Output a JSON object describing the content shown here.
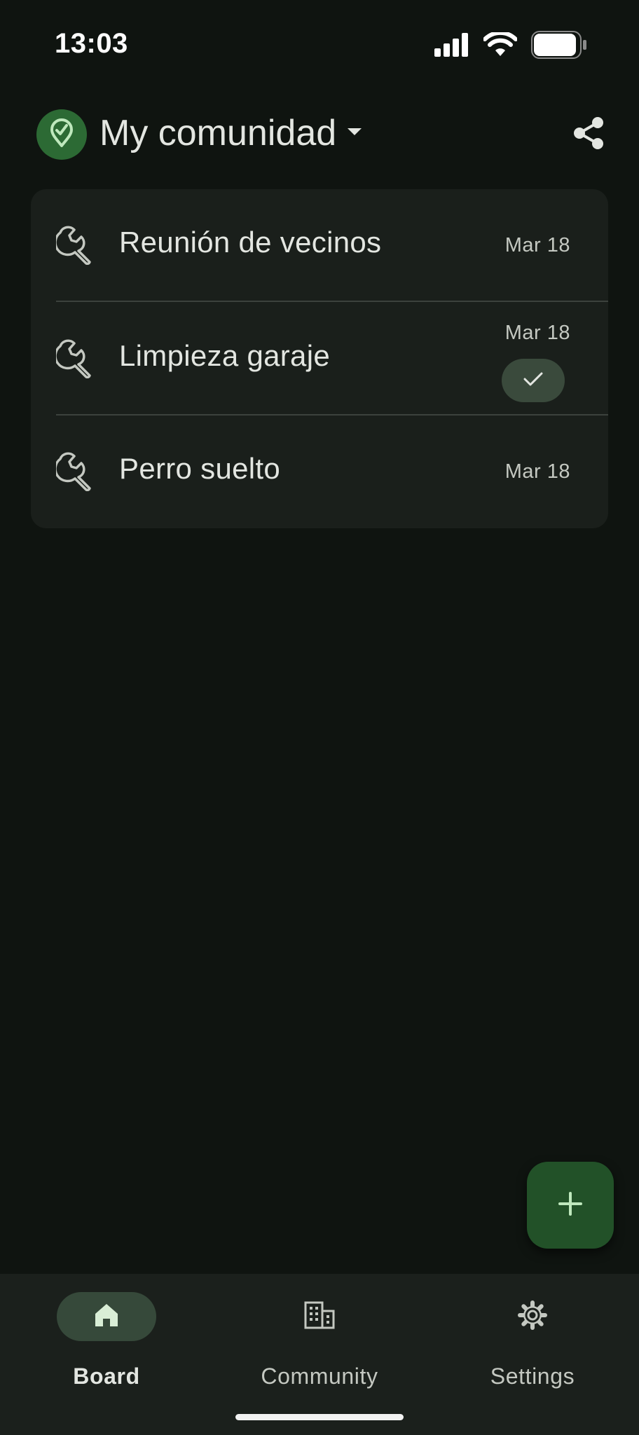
{
  "status_bar": {
    "time": "13:03",
    "icons": [
      "cellular-signal-icon",
      "wifi-icon",
      "battery-icon"
    ]
  },
  "header": {
    "community_name": "My comunidad",
    "logo_icon": "map-pin-check-icon",
    "dropdown_icon": "caret-down-icon",
    "share_icon": "share-icon"
  },
  "list": {
    "items": [
      {
        "title": "Reunión de vecinos",
        "date": "Mar 18",
        "icon": "wrench-icon",
        "done": false
      },
      {
        "title": "Limpieza garaje",
        "date": "Mar 18",
        "icon": "wrench-icon",
        "done": true
      },
      {
        "title": "Perro suelto",
        "date": "Mar 18",
        "icon": "wrench-icon",
        "done": false
      }
    ]
  },
  "fab": {
    "icon": "plus-icon"
  },
  "bottom_nav": {
    "items": [
      {
        "label": "Board",
        "icon": "home-icon",
        "active": true
      },
      {
        "label": "Community",
        "icon": "building-icon",
        "active": false
      },
      {
        "label": "Settings",
        "icon": "gear-icon",
        "active": false
      }
    ]
  },
  "colors": {
    "background": "#0f1410",
    "card": "#1a1f1b",
    "accent_green": "#2c6a34",
    "fab": "#225128",
    "nav_active_pill": "#36493a",
    "text_primary": "#e3e6e1",
    "text_secondary": "#c4c8c1"
  }
}
